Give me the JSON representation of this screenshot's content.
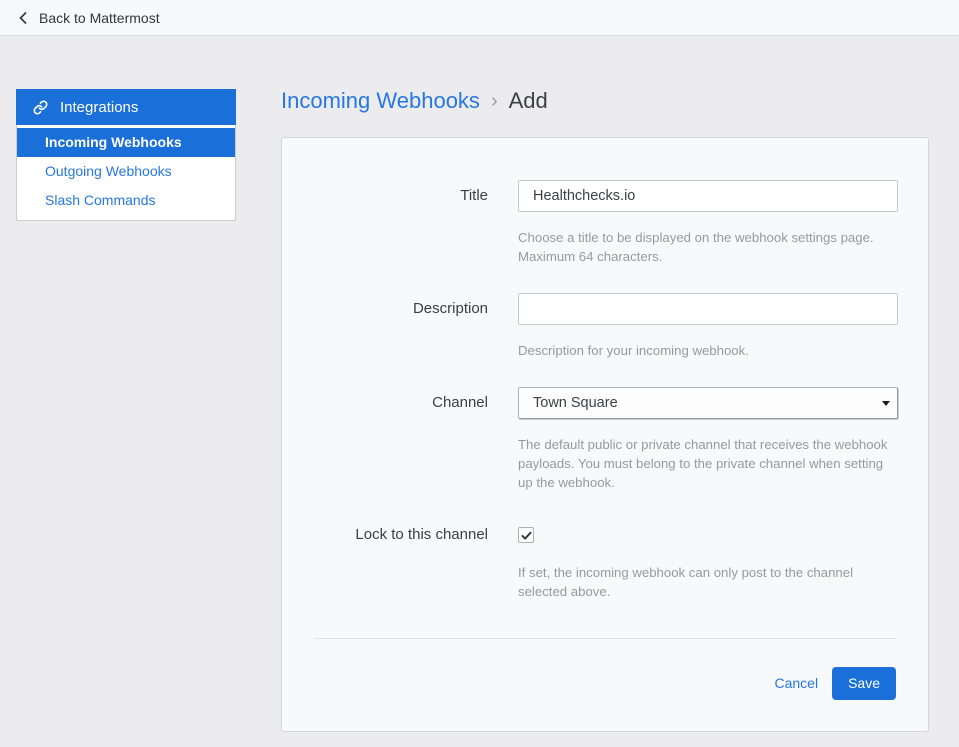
{
  "topbar": {
    "back_label": "Back to Mattermost"
  },
  "sidebar": {
    "header": "Integrations",
    "items": [
      {
        "label": "Incoming Webhooks",
        "active": true
      },
      {
        "label": "Outgoing Webhooks",
        "active": false
      },
      {
        "label": "Slash Commands",
        "active": false
      }
    ]
  },
  "breadcrumb": {
    "parent": "Incoming Webhooks",
    "separator": "›",
    "current": "Add"
  },
  "form": {
    "title": {
      "label": "Title",
      "value": "Healthchecks.io",
      "help": "Choose a title to be displayed on the webhook settings page. Maximum 64 characters."
    },
    "description": {
      "label": "Description",
      "value": "",
      "placeholder": "",
      "help": "Description for your incoming webhook."
    },
    "channel": {
      "label": "Channel",
      "selected": "Town Square",
      "help": "The default public or private channel that receives the webhook payloads. You must belong to the private channel when setting up the webhook."
    },
    "lock": {
      "label": "Lock to this channel",
      "checked": true,
      "help": "If set, the incoming webhook can only post to the channel selected above."
    },
    "actions": {
      "cancel": "Cancel",
      "save": "Save"
    }
  },
  "colors": {
    "primary_blue": "#1a6fd8",
    "link_blue": "#2677e2",
    "page_bg": "#ececee",
    "card_bg": "#f8f9fa",
    "topbar_bg": "#f8f9fb",
    "help_text": "#97999d"
  }
}
